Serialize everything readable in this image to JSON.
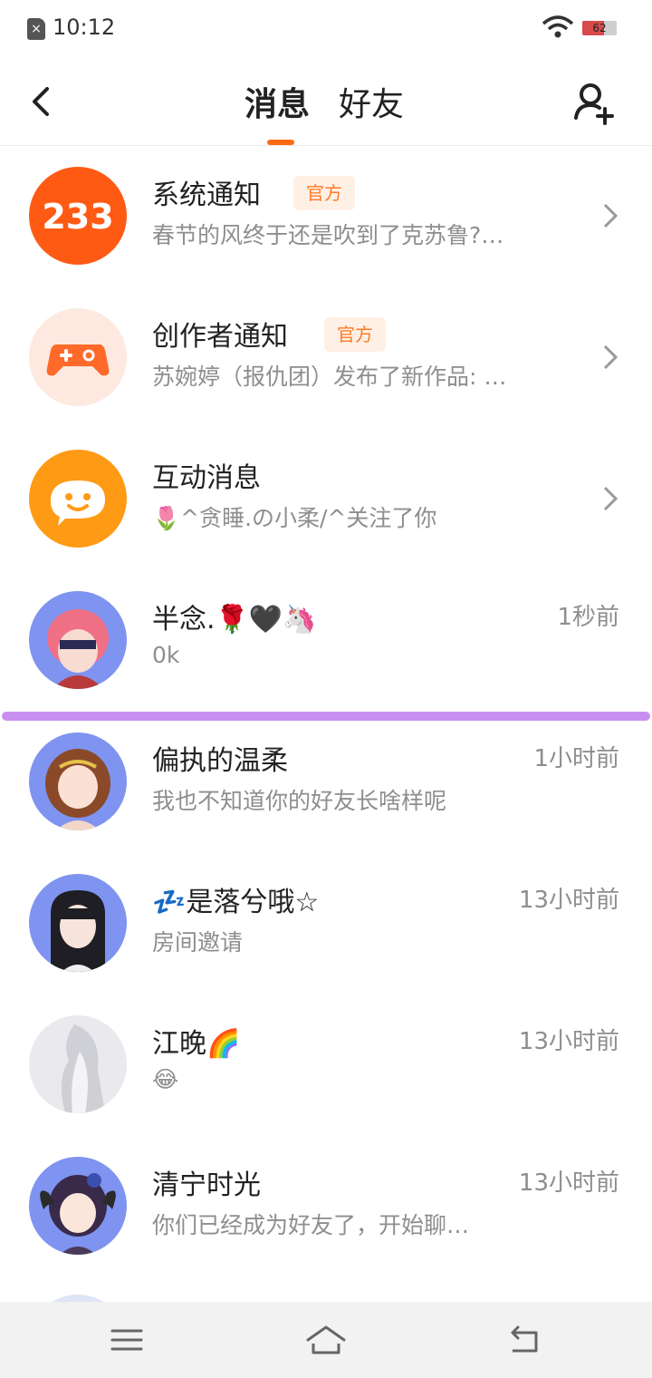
{
  "status": {
    "time": "10:12",
    "battery": "62",
    "battery_level": 0.62
  },
  "header": {
    "tabs": [
      "消息",
      "好友"
    ],
    "active_tab": "消息"
  },
  "official_badge": "官方",
  "colors": {
    "accent": "#ff6a13",
    "divider": "#c98ff0"
  },
  "notifications": [
    {
      "title": "系统通知",
      "subtitle": "春节的风终于还是吹到了克苏鲁?…",
      "icon": "233-logo",
      "avatar_text": "233"
    },
    {
      "title": "创作者通知",
      "subtitle": "苏婉婷（报仇团）发布了新作品: …",
      "icon": "gamepad-icon"
    },
    {
      "title": "互动消息",
      "subtitle": "🌷^贪睡.の小柔/^关注了你",
      "icon": "chat-smile-icon"
    }
  ],
  "chats": [
    {
      "name": "半念.🌹🖤🦄",
      "message": "0k",
      "time": "1秒前"
    },
    {
      "name": "偏执的温柔",
      "message": "我也不知道你的好友长啥样呢",
      "time": "1小时前"
    },
    {
      "name": "💤是落兮哦☆",
      "message": "房间邀请",
      "time": "13小时前"
    },
    {
      "name": "江晚🌈",
      "message": "😂",
      "time": "13小时前"
    },
    {
      "name": "清宁时光",
      "message": "你们已经成为好友了，开始聊…",
      "time": "13小时前"
    }
  ]
}
